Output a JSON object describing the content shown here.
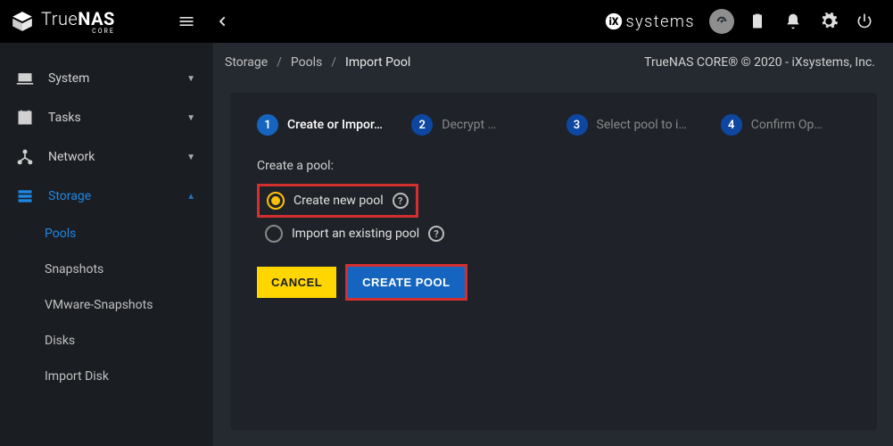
{
  "brand": {
    "name": "TrueNAS",
    "sub": "CORE"
  },
  "partner": {
    "name": "systems",
    "prefix": "iX"
  },
  "topbar_icons": {
    "menu": "menu",
    "back": "back",
    "dash": "dashboard",
    "clip": "clipboard",
    "bell": "notifications",
    "gear": "settings",
    "power": "power"
  },
  "sidebar": {
    "items": [
      {
        "label": "System",
        "icon": "laptop",
        "expandable": true
      },
      {
        "label": "Tasks",
        "icon": "calendar",
        "expandable": true
      },
      {
        "label": "Network",
        "icon": "network",
        "expandable": true
      },
      {
        "label": "Storage",
        "icon": "storage",
        "expandable": true,
        "active": true
      }
    ],
    "storage_children": [
      {
        "label": "Pools",
        "active": true
      },
      {
        "label": "Snapshots"
      },
      {
        "label": "VMware-Snapshots"
      },
      {
        "label": "Disks"
      },
      {
        "label": "Import Disk"
      }
    ]
  },
  "breadcrumb": {
    "root": "Storage",
    "mid": "Pools",
    "leaf": "Import Pool"
  },
  "copyright": "TrueNAS CORE® © 2020 - iXsystems, Inc.",
  "stepper": [
    {
      "num": "1",
      "label": "Create or Impor…",
      "active": true
    },
    {
      "num": "2",
      "label": "Decrypt …"
    },
    {
      "num": "3",
      "label": "Select pool to i…"
    },
    {
      "num": "4",
      "label": "Confirm Op…"
    }
  ],
  "form": {
    "section_label": "Create a pool:",
    "option_create": "Create new pool",
    "option_import": "Import an existing pool",
    "cancel": "CANCEL",
    "submit": "CREATE POOL"
  }
}
